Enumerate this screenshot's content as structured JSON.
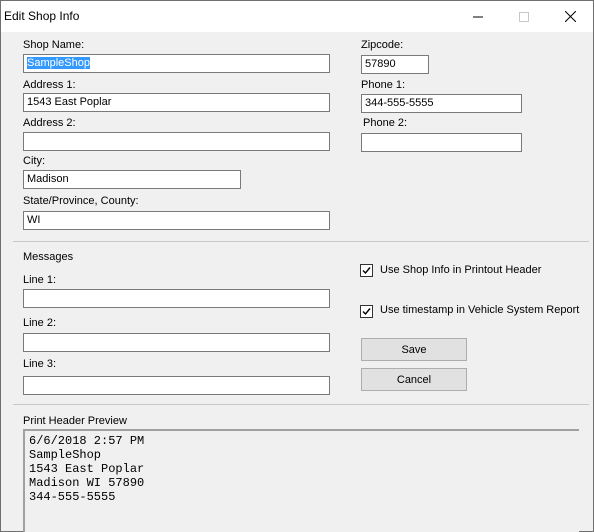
{
  "window": {
    "title": "Edit Shop Info",
    "minimize_icon": "minimize-icon",
    "maximize_icon": "maximize-icon",
    "close_icon": "close-icon"
  },
  "shop": {
    "name_label": "Shop Name:",
    "name_value": "SampleShop",
    "address1_label": "Address 1:",
    "address1_value": "1543 East Poplar",
    "address2_label": "Address 2:",
    "address2_value": "",
    "city_label": "City:",
    "city_value": "Madison",
    "state_label": "State/Province, County:",
    "state_value": "WI",
    "zip_label": "Zipcode:",
    "zip_value": "57890",
    "phone1_label": "Phone 1:",
    "phone1_value": "344-555-5555",
    "phone2_label": "Phone 2:",
    "phone2_value": ""
  },
  "messages": {
    "section_label": "Messages",
    "line1_label": "Line 1:",
    "line1_value": "",
    "line2_label": "Line 2:",
    "line2_value": "",
    "line3_label": "Line 3:",
    "line3_value": ""
  },
  "options": {
    "use_shop_info_label": "Use Shop Info in Printout Header",
    "use_shop_info_checked": true,
    "use_timestamp_label": "Use timestamp in Vehicle System Report",
    "use_timestamp_checked": true
  },
  "buttons": {
    "save_label": "Save",
    "cancel_label": "Cancel"
  },
  "preview": {
    "section_label": "Print Header Preview",
    "lines": [
      "6/6/2018 2:57 PM",
      "SampleShop",
      "1543 East Poplar",
      "Madison WI 57890",
      "344-555-5555"
    ]
  }
}
